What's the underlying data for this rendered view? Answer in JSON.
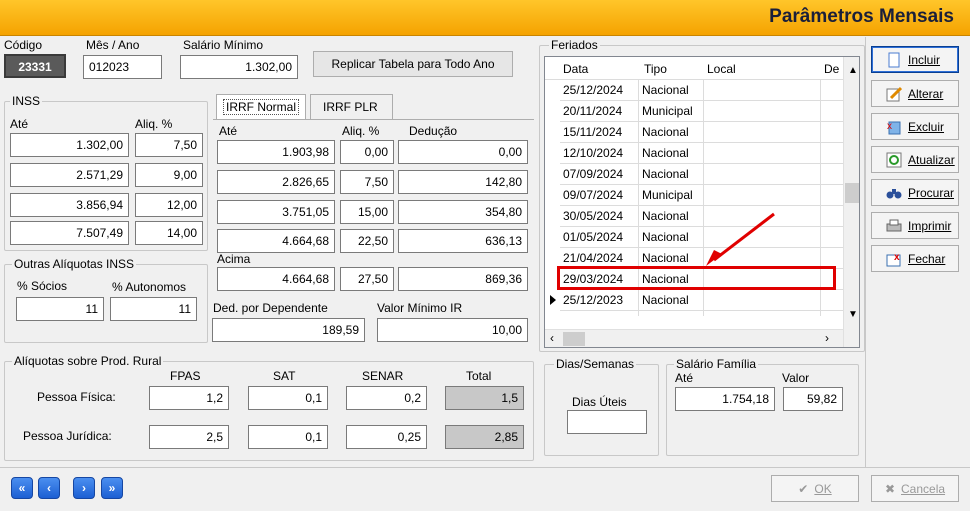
{
  "title": "Parâmetros Mensais",
  "header": {
    "codigo_label": "Código",
    "codigo_value": "23331",
    "mesano_label": "Mês / Ano",
    "mesano_value": "012023",
    "salario_label": "Salário Mínimo",
    "salario_value": "1.302,00",
    "replicar_label": "Replicar Tabela para Todo Ano"
  },
  "inss": {
    "title": "INSS",
    "ate_label": "Até",
    "aliq_label": "Aliq. %",
    "rows": [
      {
        "ate": "1.302,00",
        "aliq": "7,50"
      },
      {
        "ate": "2.571,29",
        "aliq": "9,00"
      },
      {
        "ate": "3.856,94",
        "aliq": "12,00"
      },
      {
        "ate": "7.507,49",
        "aliq": "14,00"
      }
    ]
  },
  "irrf": {
    "tabs": [
      "IRRF Normal",
      "IRRF PLR"
    ],
    "ate_label": "Até",
    "aliq_label": "Aliq. %",
    "deducao_label": "Dedução",
    "rows": [
      {
        "ate": "1.903,98",
        "aliq": "0,00",
        "deducao": "0,00"
      },
      {
        "ate": "2.826,65",
        "aliq": "7,50",
        "deducao": "142,80"
      },
      {
        "ate": "3.751,05",
        "aliq": "15,00",
        "deducao": "354,80"
      },
      {
        "ate": "4.664,68",
        "aliq": "22,50",
        "deducao": "636,13"
      }
    ],
    "acima_label": "Acima",
    "acima": {
      "ate": "4.664,68",
      "aliq": "27,50",
      "deducao": "869,36"
    },
    "dependente_label": "Ded. por Dependente",
    "dependente_value": "189,59",
    "minimo_label": "Valor Mínimo IR",
    "minimo_value": "10,00"
  },
  "outras": {
    "title": "Outras Alíquotas INSS",
    "socios_label": "% Sócios",
    "socios_value": "11",
    "autonomos_label": "% Autonomos",
    "autonomos_value": "11"
  },
  "rural": {
    "title": "Alíquotas sobre Prod. Rural",
    "cols": [
      "FPAS",
      "SAT",
      "SENAR",
      "Total"
    ],
    "fisica_label": "Pessoa Física:",
    "fisica": [
      "1,2",
      "0,1",
      "0,2",
      "1,5"
    ],
    "juridica_label": "Pessoa Jurídica:",
    "juridica": [
      "2,5",
      "0,1",
      "0,25",
      "2,85"
    ]
  },
  "feriados": {
    "title": "Feriados",
    "columns": [
      "Data",
      "Tipo",
      "Local",
      "De"
    ],
    "rows": [
      {
        "data": "25/12/2024",
        "tipo": "Nacional"
      },
      {
        "data": "20/11/2024",
        "tipo": "Municipal"
      },
      {
        "data": "15/11/2024",
        "tipo": "Nacional"
      },
      {
        "data": "12/10/2024",
        "tipo": "Nacional"
      },
      {
        "data": "07/09/2024",
        "tipo": "Nacional"
      },
      {
        "data": "09/07/2024",
        "tipo": "Municipal"
      },
      {
        "data": "30/05/2024",
        "tipo": "Nacional"
      },
      {
        "data": "01/05/2024",
        "tipo": "Nacional"
      },
      {
        "data": "21/04/2024",
        "tipo": "Nacional"
      },
      {
        "data": "29/03/2024",
        "tipo": "Nacional"
      },
      {
        "data": "25/12/2023",
        "tipo": "Nacional"
      }
    ]
  },
  "dias": {
    "title": "Dias/Semanas",
    "uteis_label": "Dias Úteis",
    "uteis_value": ""
  },
  "familia": {
    "title": "Salário Família",
    "ate_label": "Até",
    "valor_label": "Valor",
    "ate_value": "1.754,18",
    "valor_value": "59,82"
  },
  "sidebar": {
    "incluir": "Incluir",
    "alterar": "Alterar",
    "excluir": "Excluir",
    "atualizar": "Atualizar",
    "procurar": "Procurar",
    "imprimir": "Imprimir",
    "fechar": "Fechar"
  },
  "footer": {
    "ok": "OK",
    "cancela": "Cancela",
    "nav": [
      "«",
      "‹",
      "›",
      "»"
    ]
  },
  "colors": {
    "title_bar": "#f5a300",
    "highlight": "#e00000",
    "nav_blue": "#1c5fd3"
  }
}
